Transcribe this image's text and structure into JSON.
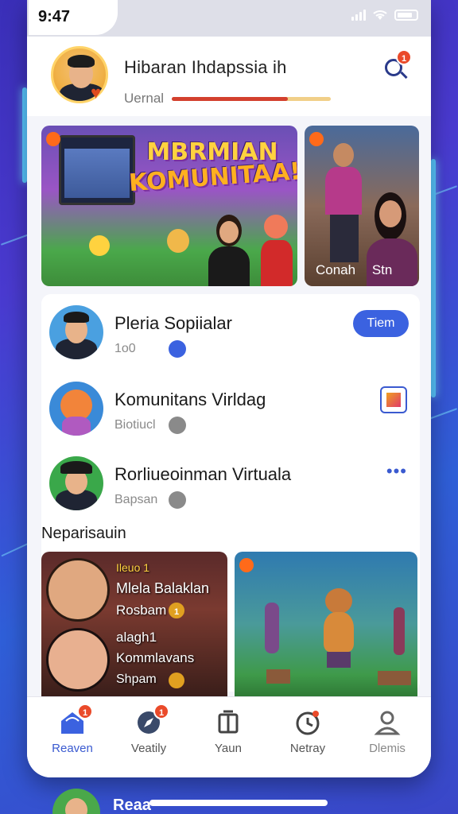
{
  "status_bar": {
    "time": "9:47"
  },
  "header": {
    "title": "Hibaran Ihdapssia ih",
    "subtitle": "Uernal",
    "progress": 0.73,
    "search_badge": "1"
  },
  "banner": {
    "title_line1": "MBRMIAN",
    "title_line2": "KOMUNITAA!",
    "side_caption": "Conah Stn"
  },
  "list": [
    {
      "title": "Pleria Sopiialar",
      "sub": "1o0",
      "action": "Tiem"
    },
    {
      "title": "Komunitans Virldag",
      "sub": "Biotiucl"
    },
    {
      "title": "Rorliueoinman Virtuala",
      "sub": "Bapsan"
    }
  ],
  "section": {
    "title": "Neparisauin"
  },
  "tiles": {
    "left": {
      "tag": "Ileuo 1",
      "name": "Mlela Balaklan",
      "sub": "Rosbam",
      "sub_badge": "1",
      "name2": "alagh1",
      "name3": "Kommlavans",
      "sub2": "Shpam"
    }
  },
  "tabs": [
    {
      "label": "Reaven",
      "icon": "home-icon",
      "badge": "1",
      "active": true
    },
    {
      "label": "Veatily",
      "icon": "compass-icon",
      "badge": "1",
      "active": false
    },
    {
      "label": "Yaun",
      "icon": "tv-icon",
      "active": false
    },
    {
      "label": "Netray",
      "icon": "clock-icon",
      "active": false
    },
    {
      "label": "Dlemis",
      "icon": "profile-icon",
      "active": false
    }
  ],
  "peek": {
    "text": "Reaa"
  },
  "colors": {
    "accent": "#3b62e0",
    "notify": "#ea4a2a",
    "progress": "#d3402e"
  }
}
